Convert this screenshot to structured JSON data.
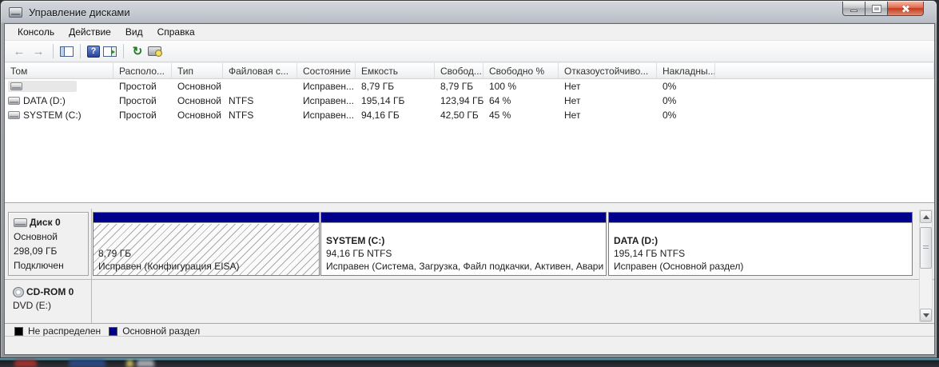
{
  "window": {
    "title": "Управление дисками"
  },
  "menu": {
    "items": [
      "Консоль",
      "Действие",
      "Вид",
      "Справка"
    ]
  },
  "toolbar": {
    "back_glyph": "←",
    "forward_glyph": "→",
    "help_glyph": "?",
    "refresh_glyph": "↻"
  },
  "volume_list": {
    "headers": [
      "Том",
      "Располо...",
      "Тип",
      "Файловая с...",
      "Состояние",
      "Емкость",
      "Свобод...",
      "Свободно %",
      "Отказоустойчиво...",
      "Накладны..."
    ],
    "rows": [
      [
        "",
        "Простой",
        "Основной",
        "",
        "Исправен...",
        "8,79 ГБ",
        "8,79 ГБ",
        "100 %",
        "Нет",
        "0%"
      ],
      [
        "DATA (D:)",
        "Простой",
        "Основной",
        "NTFS",
        "Исправен...",
        "195,14 ГБ",
        "123,94 ГБ",
        "64 %",
        "Нет",
        "0%"
      ],
      [
        "SYSTEM (C:)",
        "Простой",
        "Основной",
        "NTFS",
        "Исправен...",
        "94,16 ГБ",
        "42,50 ГБ",
        "45 %",
        "Нет",
        "0%"
      ]
    ]
  },
  "disk0": {
    "name": "Диск 0",
    "type": "Основной",
    "size": "298,09 ГБ",
    "status": "Подключен",
    "partitions": [
      {
        "label": "",
        "line1": "8,79 ГБ",
        "line2": "Исправен (Конфигурация EISA)"
      },
      {
        "label": "SYSTEM  (C:)",
        "line1": "94,16 ГБ NTFS",
        "line2": "Исправен (Система, Загрузка, Файл подкачки, Активен, Авари"
      },
      {
        "label": "DATA  (D:)",
        "line1": "195,14 ГБ NTFS",
        "line2": "Исправен (Основной раздел)"
      }
    ]
  },
  "cdrom": {
    "name": "CD-ROM 0",
    "line2": "DVD (E:)"
  },
  "legend": {
    "items": [
      {
        "label": "Не распределен",
        "color": "#000000"
      },
      {
        "label": "Основной раздел",
        "color": "#00008B"
      }
    ]
  },
  "colors": {
    "partition_bar": "#00008B"
  }
}
